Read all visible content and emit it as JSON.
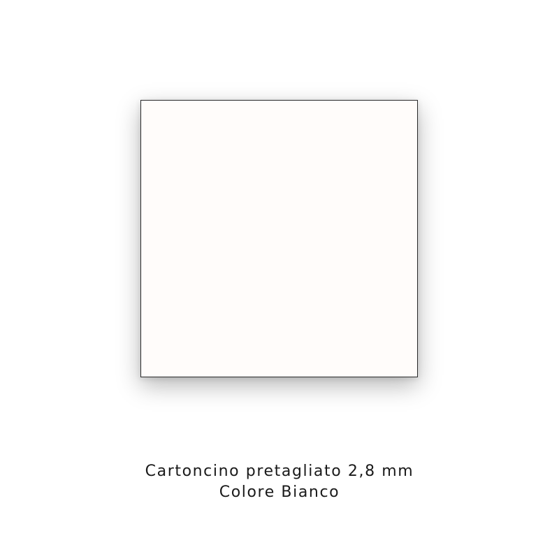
{
  "product": {
    "board_color": "#fffcfa",
    "border_color": "#2a2a2a",
    "caption_line_1": "Cartoncino pretagliato 2,8 mm",
    "caption_line_2": "Colore Bianco"
  }
}
